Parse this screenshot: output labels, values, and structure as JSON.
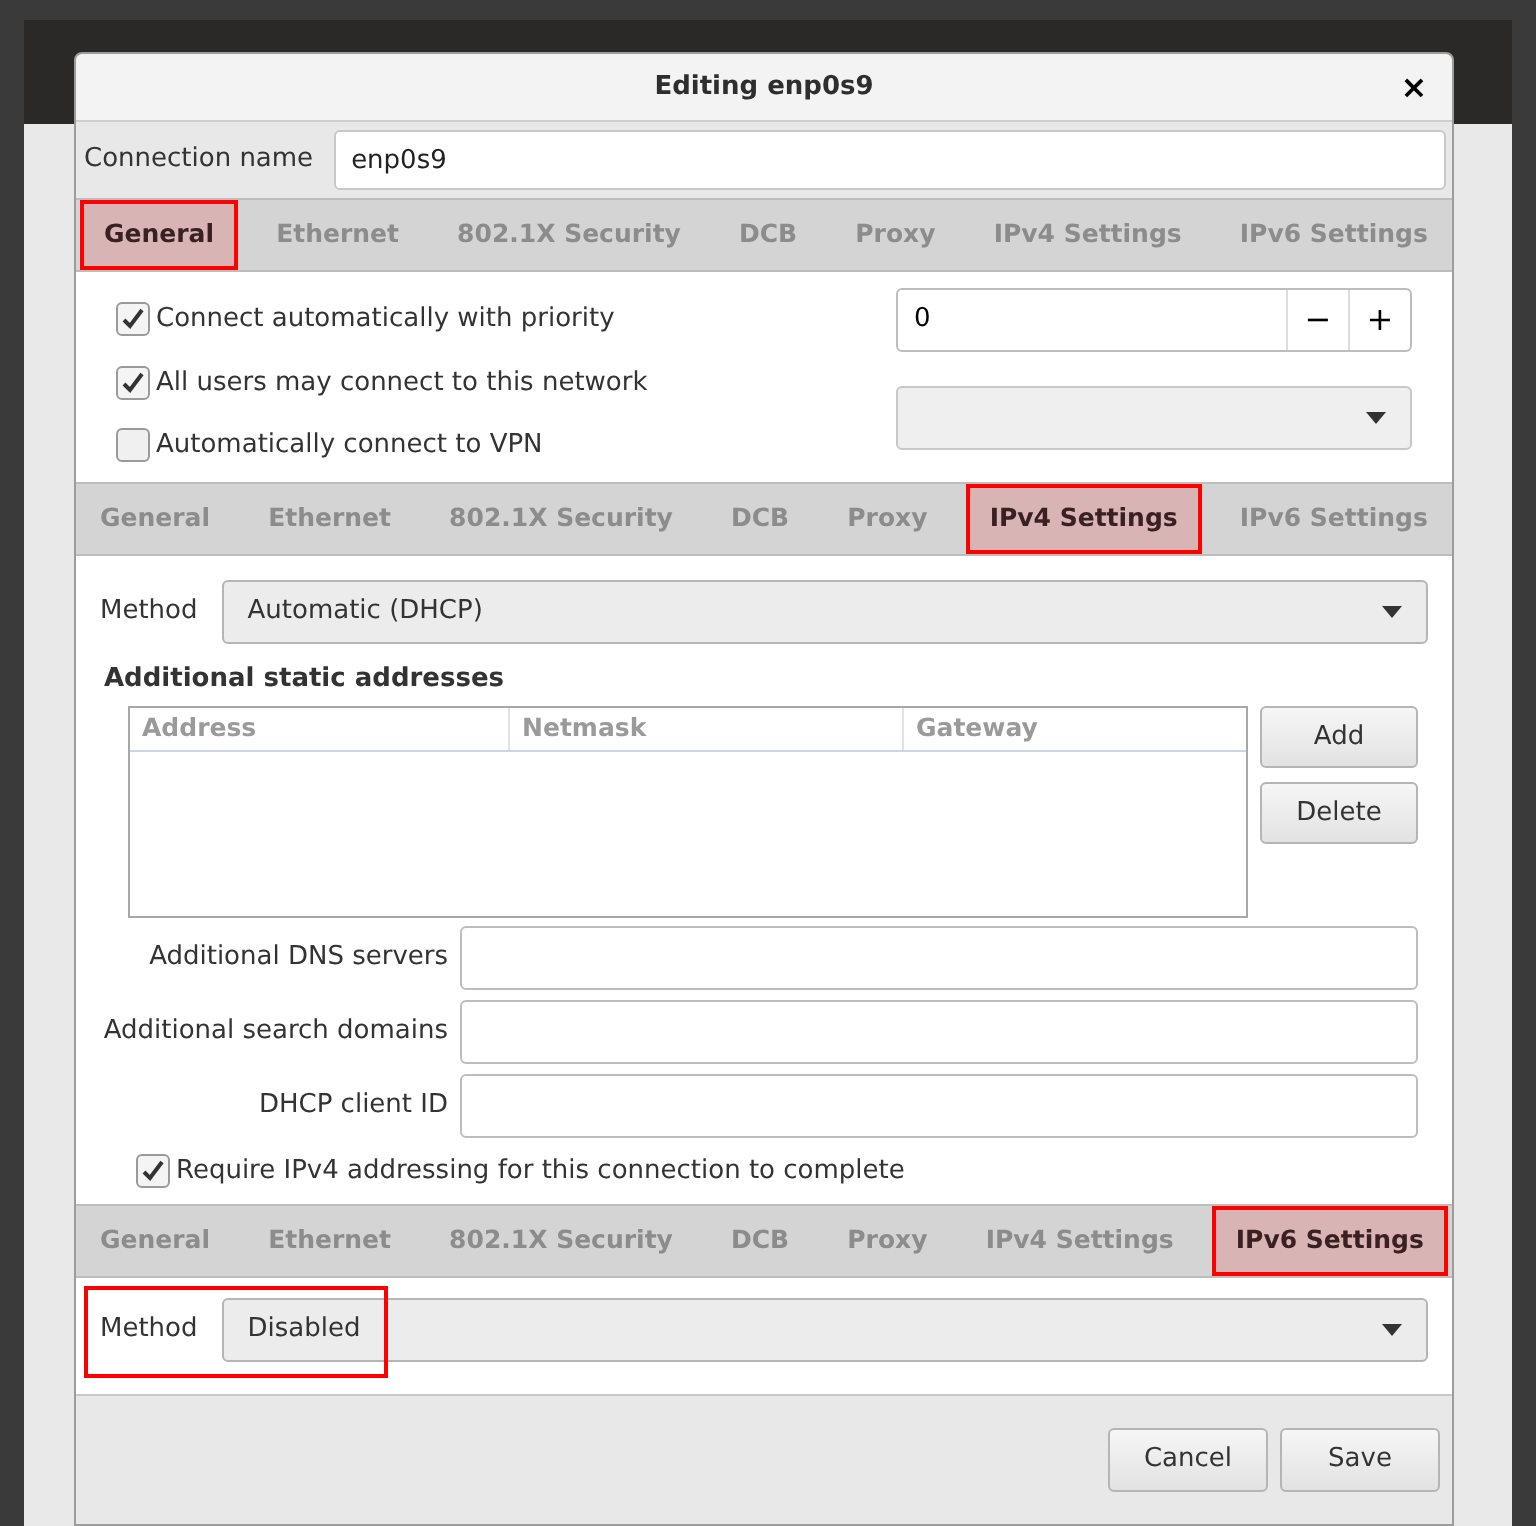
{
  "dialog": {
    "title": "Editing enp0s9",
    "close": "×"
  },
  "connection_name": {
    "label": "Connection name",
    "value": "enp0s9"
  },
  "panels": [
    {
      "kind": "general",
      "tabs": [
        {
          "label": "General",
          "selected": true
        },
        {
          "label": "Ethernet",
          "selected": false
        },
        {
          "label": "802.1X Security",
          "selected": false
        },
        {
          "label": "DCB",
          "selected": false
        },
        {
          "label": "Proxy",
          "selected": false
        },
        {
          "label": "IPv4 Settings",
          "selected": false
        },
        {
          "label": "IPv6 Settings",
          "selected": false
        }
      ],
      "options": [
        {
          "label": "Connect automatically with priority",
          "checked": true
        },
        {
          "label": "All users may connect to this network",
          "checked": true
        },
        {
          "label": "Automatically connect to VPN",
          "checked": false
        }
      ],
      "priority": {
        "value": "0",
        "decrement": "−",
        "increment": "+"
      }
    },
    {
      "kind": "ipv4",
      "tabs": [
        {
          "label": "General",
          "selected": false
        },
        {
          "label": "Ethernet",
          "selected": false
        },
        {
          "label": "802.1X Security",
          "selected": false
        },
        {
          "label": "DCB",
          "selected": false
        },
        {
          "label": "Proxy",
          "selected": false
        },
        {
          "label": "IPv4 Settings",
          "selected": true
        },
        {
          "label": "IPv6 Settings",
          "selected": false
        }
      ],
      "method": {
        "label": "Method",
        "value": "Automatic (DHCP)",
        "highlighted": false
      },
      "addresses": {
        "title": "Additional static addresses",
        "columns": [
          "Address",
          "Netmask",
          "Gateway"
        ],
        "buttons": [
          "Add",
          "Delete"
        ]
      },
      "fields": [
        {
          "label": "Additional DNS servers"
        },
        {
          "label": "Additional search domains"
        },
        {
          "label": "DHCP client ID"
        }
      ],
      "require": {
        "label": "Require IPv4 addressing for this connection to complete",
        "checked": true
      }
    },
    {
      "kind": "ipv6",
      "tabs": [
        {
          "label": "General",
          "selected": false
        },
        {
          "label": "Ethernet",
          "selected": false
        },
        {
          "label": "802.1X Security",
          "selected": false
        },
        {
          "label": "DCB",
          "selected": false
        },
        {
          "label": "Proxy",
          "selected": false
        },
        {
          "label": "IPv4 Settings",
          "selected": false
        },
        {
          "label": "IPv6 Settings",
          "selected": true
        }
      ],
      "method": {
        "label": "Method",
        "value": "Disabled",
        "highlighted": true
      }
    }
  ],
  "buttons": [
    "Cancel",
    "Save"
  ]
}
